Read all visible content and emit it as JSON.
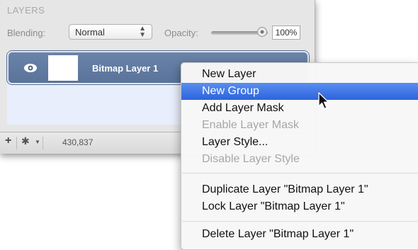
{
  "panel": {
    "title": "LAYERS",
    "blending_label": "Blending:",
    "blending_value": "Normal",
    "opacity_label": "Opacity:",
    "opacity_value": "100%",
    "layer_name": "Bitmap Layer 1",
    "count": "430,837",
    "colors": {
      "selected_row": "#5f789f",
      "list_bg": "#e8eefb"
    }
  },
  "menu": {
    "items": [
      {
        "label": "New Layer",
        "state": "normal"
      },
      {
        "label": "New Group",
        "state": "highlighted"
      },
      {
        "label": "Add Layer Mask",
        "state": "normal"
      },
      {
        "label": "Enable Layer Mask",
        "state": "disabled"
      },
      {
        "label": "Layer Style...",
        "state": "normal"
      },
      {
        "label": "Disable Layer Style",
        "state": "disabled"
      },
      {
        "label": "Duplicate Layer \"Bitmap Layer 1\"",
        "state": "normal"
      },
      {
        "label": "Lock Layer \"Bitmap Layer 1\"",
        "state": "normal"
      },
      {
        "label": "Delete Layer \"Bitmap Layer 1\"",
        "state": "normal"
      }
    ],
    "colors": {
      "highlight": "#3d74e6",
      "disabled_text": "#a7a7a7"
    }
  }
}
